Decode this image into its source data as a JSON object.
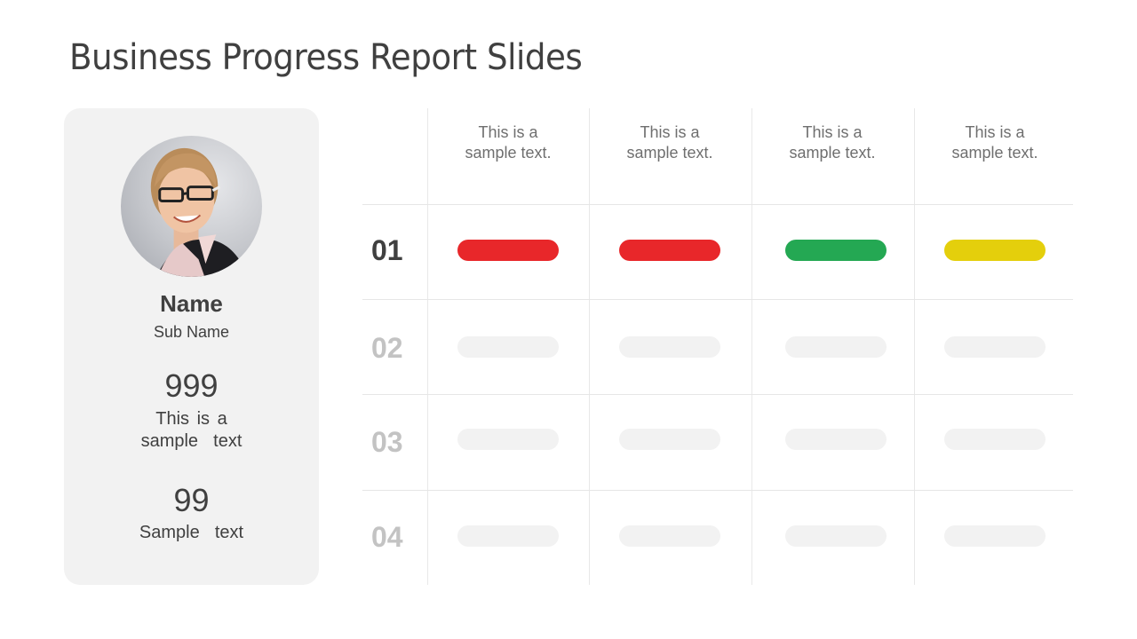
{
  "slide": {
    "title": "Business Progress Report Slides"
  },
  "profile": {
    "photo": "person-photo",
    "name": "Name",
    "sub_name": "Sub Name",
    "stats": [
      {
        "value": "999",
        "label_line1": "This is a",
        "label_line2": "sample  text"
      },
      {
        "value": "99",
        "label": "Sample  text"
      }
    ]
  },
  "table": {
    "columns": [
      {
        "line1": "This is a",
        "line2": "sample text."
      },
      {
        "line1": "This is a",
        "line2": "sample text."
      },
      {
        "line1": "This is a",
        "line2": "sample text."
      },
      {
        "line1": "This is a",
        "line2": "sample text."
      }
    ],
    "rows": [
      {
        "label": "01",
        "active": true,
        "status": [
          "red",
          "red",
          "green",
          "yellow"
        ]
      },
      {
        "label": "02",
        "active": false,
        "status": [
          "empty",
          "empty",
          "empty",
          "empty"
        ]
      },
      {
        "label": "03",
        "active": false,
        "status": [
          "empty",
          "empty",
          "empty",
          "empty"
        ]
      },
      {
        "label": "04",
        "active": false,
        "status": [
          "empty",
          "empty",
          "empty",
          "empty"
        ]
      }
    ]
  },
  "colors": {
    "red": "#e8272a",
    "green": "#24a853",
    "yellow": "#e4cf0c",
    "empty": "#f2f2f2",
    "card_bg": "#f2f2f2",
    "text_dark": "#404040",
    "text_muted": "#c3c3c3"
  }
}
